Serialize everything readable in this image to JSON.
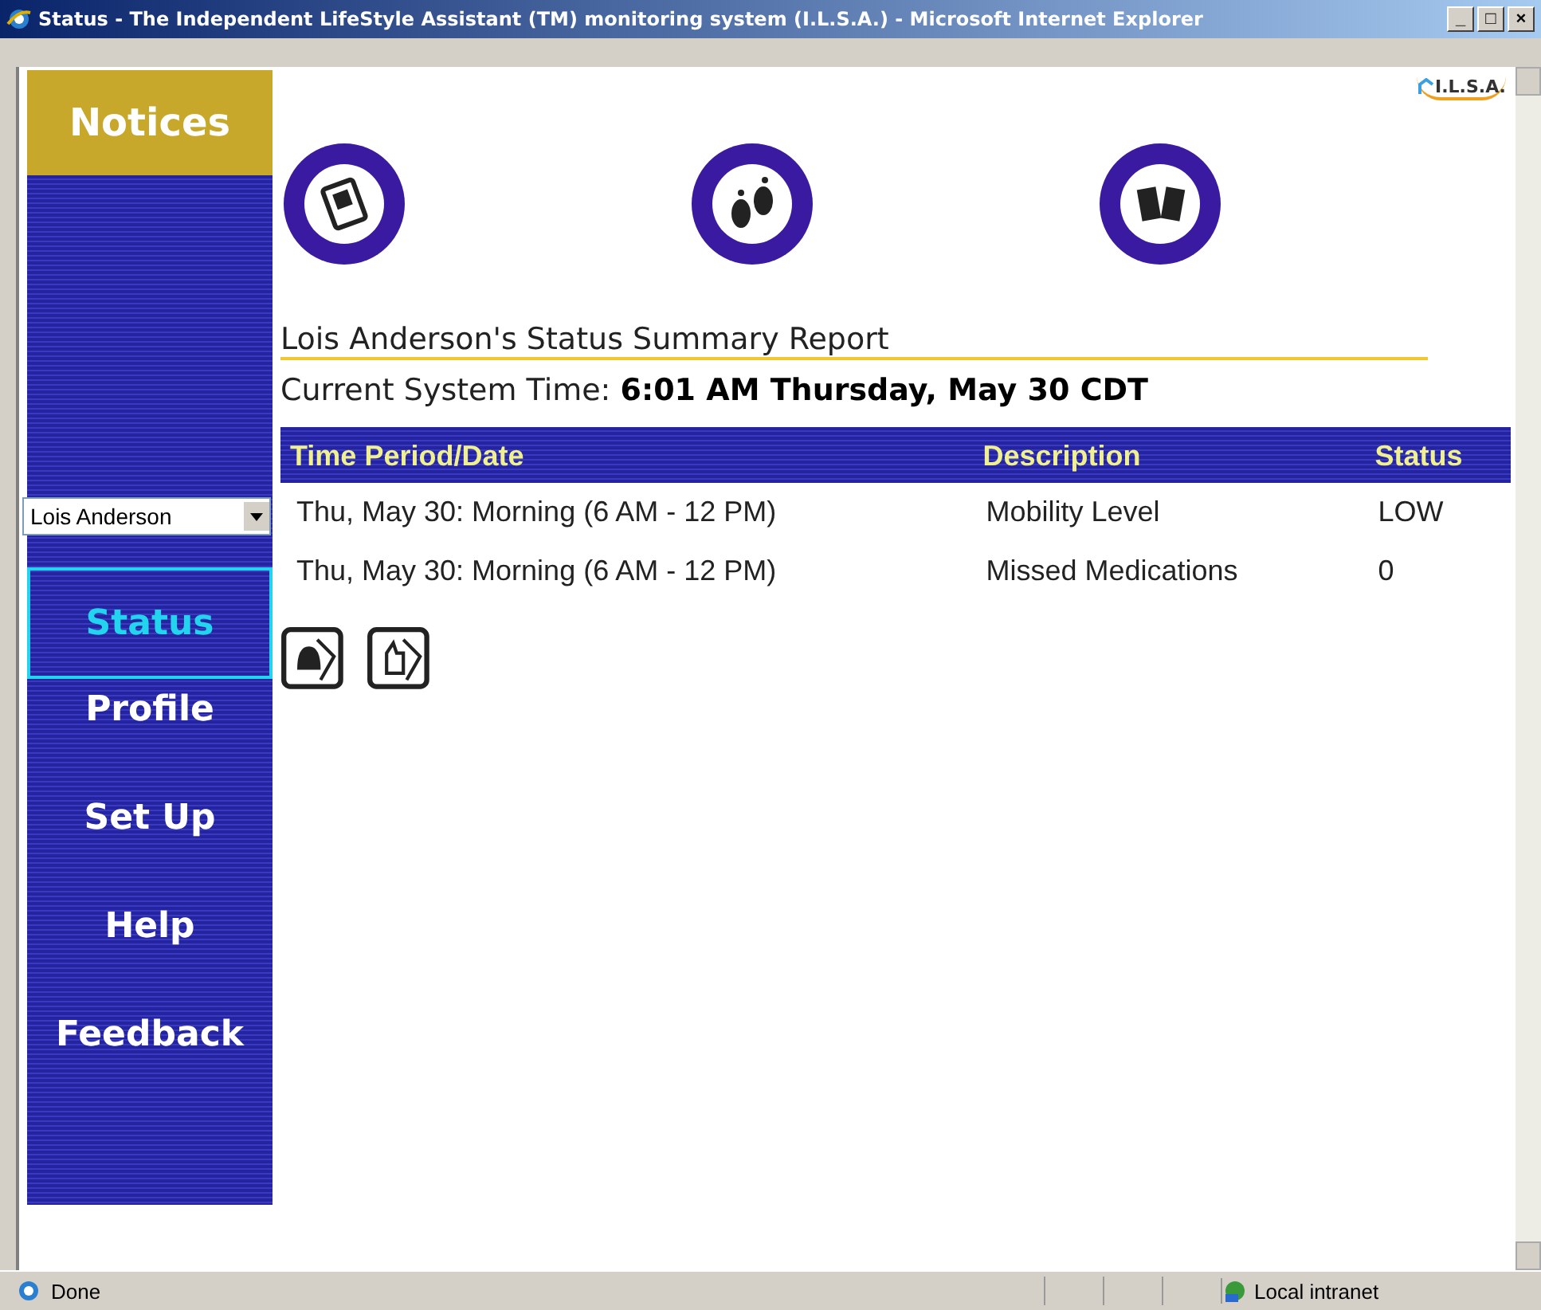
{
  "window": {
    "title": "Status - The Independent LifeStyle Assistant (TM) monitoring system (I.L.S.A.) - Microsoft Internet Explorer",
    "controls": [
      "_",
      "□",
      "×"
    ]
  },
  "logo": {
    "text": "I.L.S.A."
  },
  "sidebar": {
    "notices": "Notices",
    "person": "Lois Anderson",
    "items": [
      {
        "label": "Status",
        "selected": true
      },
      {
        "label": "Profile",
        "selected": false
      },
      {
        "label": "Set Up",
        "selected": false
      },
      {
        "label": "Help",
        "selected": false
      },
      {
        "label": "Feedback",
        "selected": false
      }
    ]
  },
  "report": {
    "title": "Lois Anderson's Status Summary Report",
    "time_label": "Current System Time:",
    "time_value": "6:01 AM Thursday, May 30 CDT"
  },
  "table": {
    "columns": [
      "Time Period/Date",
      "Description",
      "Status"
    ],
    "rows": [
      [
        "Thu, May 30: Morning (6 AM - 12 PM)",
        "Mobility Level",
        "LOW"
      ],
      [
        "Thu, May 30: Morning (6 AM - 12 PM)",
        "Missed Medications",
        "0"
      ]
    ]
  },
  "status_bar": {
    "text": "Done",
    "zone": "Local intranet"
  }
}
